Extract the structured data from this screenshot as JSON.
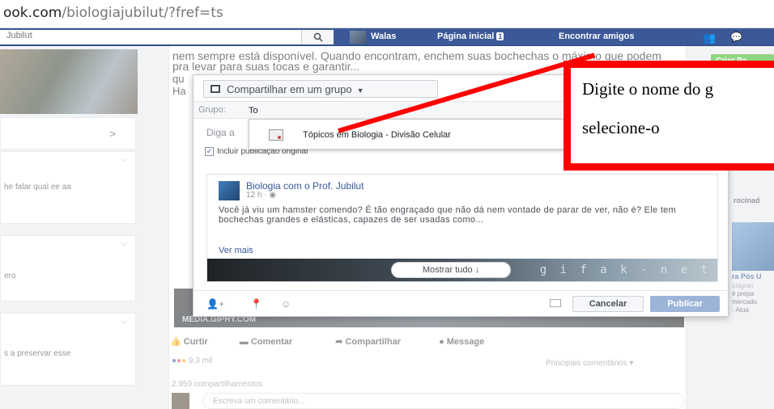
{
  "browser": {
    "url_host": "ook.com",
    "url_rest": "/biologiajubilut/?fref=ts"
  },
  "fb_header": {
    "search_value": "Jubilut",
    "user_name": "Walas",
    "home_label": "Página inicial",
    "home_badge": "1",
    "find_friends_label": "Encontrar amigos"
  },
  "background": {
    "left_chevron": ">",
    "left_snippets": [
      "he falar qual ee aa",
      "ero",
      "s a preservar esse"
    ],
    "post_text": "nem sempre está disponível. Quando encontram, enchem suas bochechas o máximo que podem pra levar para suas tocas e garantir...",
    "post_text_2": "qu",
    "post_text_3": "Ha",
    "right_button": "Criar Pa",
    "right_snippets": [
      "rocinad",
      "ra Pós U",
      "unigran",
      "é prepa",
      "mercado",
      "- Atua"
    ],
    "actions": {
      "like": "Curtir",
      "comment": "Comentar",
      "share": "Compartilhar",
      "message": "Message"
    },
    "reaction_count": "9,3 mil",
    "top_comments": "Principais comentários",
    "shares": "2.959 compartilhamentos",
    "comment_placeholder": "Escreva um comentário...",
    "media_caption": "MEDIA.GIPHY.COM"
  },
  "dialog": {
    "share_target": "Compartilhar em um grupo",
    "group_label": "Grupo:",
    "group_input": "To",
    "say_something": "Diga a",
    "include_original": "Incluir publicação original",
    "dropdown_item": "Tópicos em Biologia - Divisão Celular",
    "shared_post": {
      "author": "Biologia com o Prof. Jubilut",
      "time": "12 h · ",
      "body": "Você já viu um hamster comendo? É tão engraçado que não dá nem vontade de parar de ver, não é? Ele tem bochechas grandes e elásticas, capazes de ser usadas como...",
      "see_more": "Ver mais",
      "watermark": "g i f a k - n e t",
      "show_all": "Mostrar tudo ↓"
    },
    "cancel_label": "Cancelar",
    "publish_label": "Publicar"
  },
  "annotation": {
    "line1": "Digite o nome do g",
    "line2": "selecione-o",
    "color": "#ff0000"
  }
}
